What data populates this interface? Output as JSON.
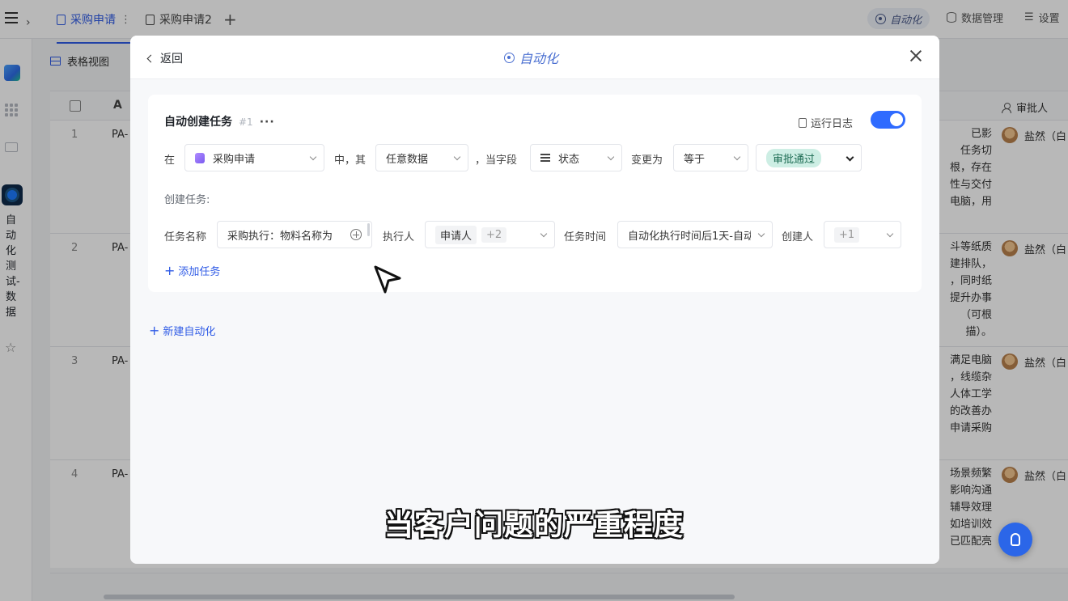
{
  "tabs": [
    {
      "label": "采购申请",
      "active": true
    },
    {
      "label": "采购申请2",
      "active": false
    }
  ],
  "topbar": {
    "automation_label": "自动化",
    "data_mgmt_label": "数据管理",
    "settings_label": "设置"
  },
  "sidebar": {
    "project_name": "自动化测试-数据"
  },
  "view": {
    "label": "表格视图"
  },
  "table": {
    "approver_header": "审批人",
    "rows": [
      {
        "num": "1",
        "id": "PA-",
        "desc": [
          "已影",
          "任务切",
          "根，存在",
          "性与交付",
          "电脑，用"
        ],
        "approver": "盐然（白"
      },
      {
        "num": "2",
        "id": "PA-",
        "desc": [
          "斗等纸质",
          "建排队，",
          "，同时纸",
          "提升办事",
          "（可根",
          "描）。"
        ],
        "approver": "盐然（白"
      },
      {
        "num": "3",
        "id": "PA-",
        "desc": [
          "满足电脑",
          "，线缆杂",
          "人体工学",
          "的改善办",
          "申请采购"
        ],
        "approver": "盐然（白"
      },
      {
        "num": "4",
        "id": "PA-",
        "desc": [
          "场景频繁",
          "影响沟通",
          "辅导效理",
          "如培训效",
          "已匹配亮"
        ],
        "approver": "盐然（白"
      }
    ]
  },
  "modal": {
    "back_label": "返回",
    "title": "自动化",
    "rule": {
      "name": "自动创建任务",
      "number": "#1",
      "more": "···",
      "run_log_label": "运行日志",
      "enabled": true,
      "trigger": {
        "in_label": "在",
        "app_value": "采购申请",
        "middle_label": "中，其",
        "data_value": "任意数据",
        "when_field_label": "，当字段",
        "field_value": "状态",
        "changes_to_label": "变更为",
        "operator_value": "等于",
        "target_value": "审批通过"
      },
      "create_task_label": "创建任务:",
      "task": {
        "name_label": "任务名称",
        "name_value": "采购执行：物料名称为",
        "assignee_label": "执行人",
        "assignee_value": "申请人",
        "assignee_extra": "+2",
        "time_label": "任务时间",
        "time_value": "自动化执行时间后1天-自动",
        "creator_label": "创建人",
        "creator_extra": "+1"
      },
      "add_task_label": "添加任务"
    },
    "new_automation_label": "新建自动化"
  },
  "subtitle": "当客户问题的严重程度",
  "colors": {
    "accent": "#2f5be6",
    "toggle": "#2f6bff",
    "tag_bg": "#cdeee4"
  }
}
